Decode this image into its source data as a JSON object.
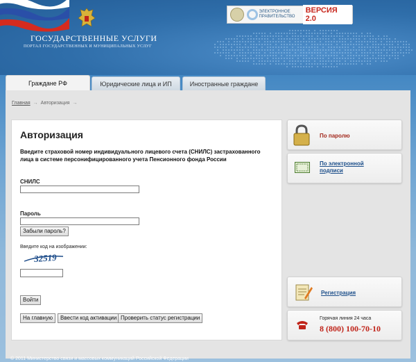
{
  "header": {
    "site_title": "ГОСУДАРСТВЕННЫЕ УСЛУГИ",
    "site_subtitle": "ПОРТАЛ ГОСУДАРСТВЕННЫХ И МУНИЦИПАЛЬНЫХ УСЛУГ",
    "egov_text": "ЭЛЕКТРОННОЕ ПРАВИТЕЛЬСТВО",
    "egov_version": "ВЕРСИЯ 2.0"
  },
  "tabs": [
    {
      "label": "Граждане РФ",
      "active": true
    },
    {
      "label": "Юридические лица и ИП",
      "active": false
    },
    {
      "label": "Иностранные граждане",
      "active": false
    }
  ],
  "breadcrumb": {
    "home": "Главная",
    "current": "Авторизация"
  },
  "form": {
    "title": "Авторизация",
    "instruction": "Введите страховой номер индивидуального лицевого счета (СНИЛС) застрахованного лица в системе персонифицированного учета Пенсионного фонда России",
    "snils_label": "СНИЛС",
    "snils_value": "",
    "password_label": "Пароль",
    "password_value": "",
    "forgot_button": "Забыли пароль?",
    "captcha_label": "Введите код на изображении:",
    "captcha_text": "32519",
    "captcha_value": "",
    "login_button": "Войти",
    "home_button": "На главную",
    "activation_button": "Ввести код активации",
    "status_button": "Проверить статус регистрации"
  },
  "sidebar": {
    "by_password": "По паролю",
    "by_signature": "По электронной подписи",
    "registration": "Регистрация",
    "hotline_label": "Горячая линия 24 часа",
    "hotline_number": "8 (800) 100-70-10"
  },
  "footer": {
    "text": "© 2011 Министерство связи и массовых коммуникаций Российской Федерации"
  },
  "colors": {
    "accent_red": "#c0241a",
    "link_blue": "#1d4f8a",
    "header_blue": "#2f6eaa"
  }
}
